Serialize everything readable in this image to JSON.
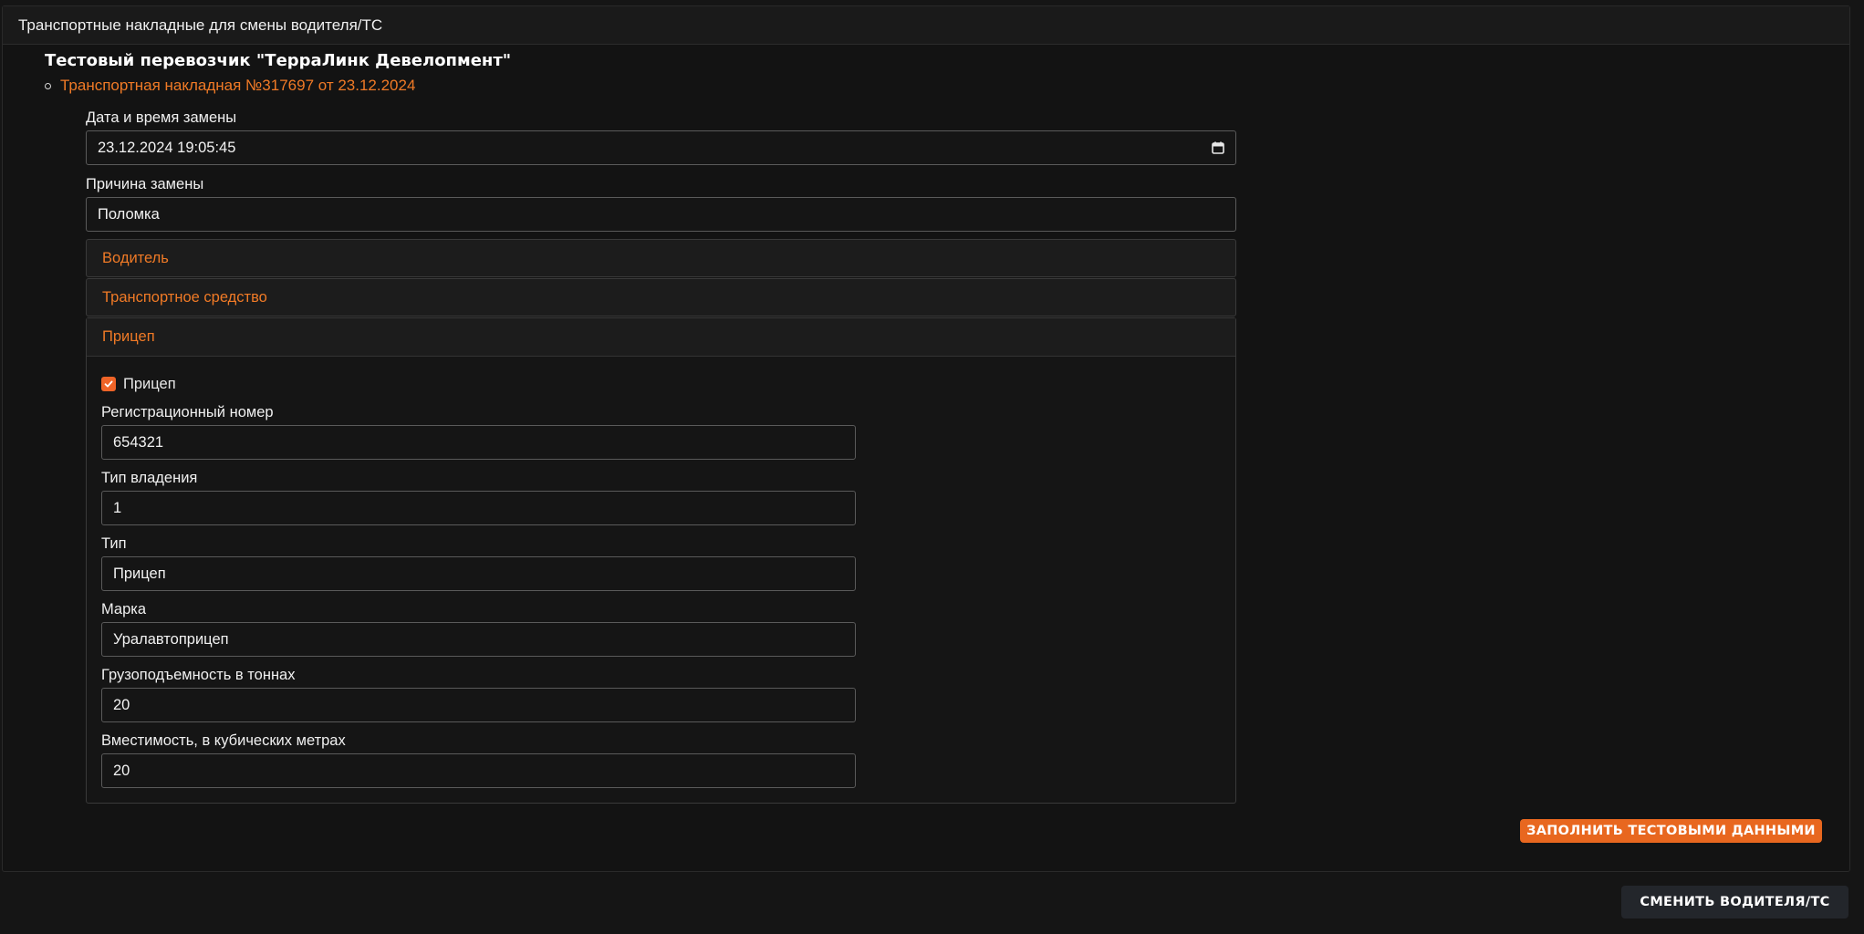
{
  "panel": {
    "title": "Транспортные накладные для смены водителя/ТС"
  },
  "carrier": {
    "name": "Тестовый перевозчик \"ТерраЛинк Девелопмент\""
  },
  "invoice": {
    "label": "Транспортная накладная №317697 от 23.12.2024"
  },
  "form": {
    "datetime": {
      "label": "Дата и время замены",
      "value": "23.12.2024 19:05:45"
    },
    "reason": {
      "label": "Причина замены",
      "value": "Поломка"
    }
  },
  "accordion": {
    "driver": {
      "title": "Водитель"
    },
    "vehicle": {
      "title": "Транспортное средство"
    },
    "trailer": {
      "title": "Прицеп",
      "checkbox_label": "Прицеп",
      "checked": true,
      "fields": {
        "reg_number": {
          "label": "Регистрационный номер",
          "value": "654321"
        },
        "ownership": {
          "label": "Тип владения",
          "value": "1"
        },
        "type": {
          "label": "Тип",
          "value": "Прицеп"
        },
        "brand": {
          "label": "Марка",
          "value": "Уралавтоприцеп"
        },
        "capacity_t": {
          "label": "Грузоподъемность в тоннах",
          "value": "20"
        },
        "volume_m3": {
          "label": "Вместимость, в кубических метрах",
          "value": "20"
        }
      }
    }
  },
  "buttons": {
    "fill_test": "ЗАПОЛНИТЬ ТЕСТОВЫМИ ДАННЫМИ",
    "change_driver": "СМЕНИТЬ ВОДИТЕЛЯ/ТС"
  },
  "colors": {
    "accent": "#ef6428",
    "background": "#151515",
    "text": "#f0f0f0"
  }
}
